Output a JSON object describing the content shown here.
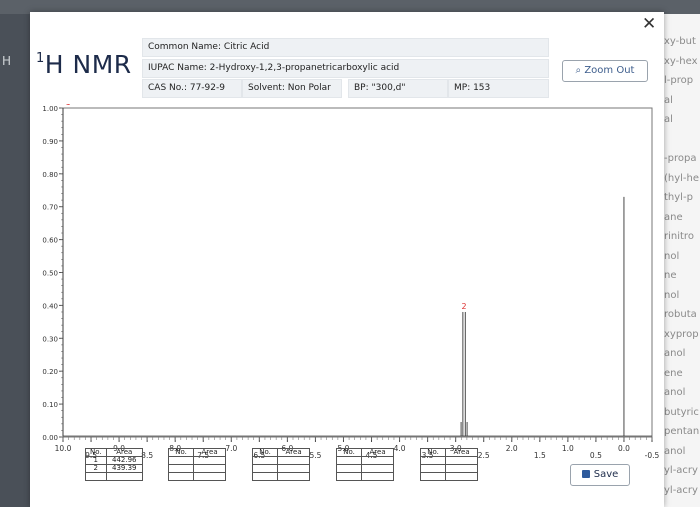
{
  "background": {
    "left_text": "H",
    "right_list": [
      "xy-but",
      "xy-hex",
      "l-prop",
      "al",
      "al",
      "",
      "-propa",
      "(hyl-he",
      "thyl-p",
      "ane",
      "rinitro",
      "nol",
      "ne",
      "nol",
      "robuta",
      "xyprop",
      "anol",
      "ene",
      "anol",
      "butyric",
      "pentan",
      "anol",
      "yl-acry",
      "yl-acry"
    ]
  },
  "dialog": {
    "title_main": "H NMR",
    "title_sup": "1",
    "close_glyph": "✕",
    "info": {
      "common_name": "Common Name: Citric Acid",
      "iupac_name": "IUPAC Name: 2-Hydroxy-1,2,3-propanetricarboxylic acid",
      "cas": "CAS No.: 77-92-9",
      "solvent": "Solvent: Non Polar",
      "bp": "BP: \"300,d\"",
      "mp": "MP: 153"
    },
    "zoom_label": "Zoom Out",
    "save_label": "Save"
  },
  "chart_data": {
    "type": "line",
    "xlabel": "",
    "ylabel": "",
    "x_ticks": [
      "10.0",
      "9.5",
      "9.0",
      "8.5",
      "8.0",
      "7.5",
      "7.0",
      "6.5",
      "6.0",
      "5.5",
      "5.0",
      "4.5",
      "4.0",
      "3.5",
      "3.0",
      "2.5",
      "2.0",
      "1.5",
      "1.0",
      "0.5",
      "0.0",
      "-0.5"
    ],
    "y_ticks": [
      "0.00",
      "0.10",
      "0.20",
      "0.30",
      "0.40",
      "0.50",
      "0.60",
      "0.70",
      "0.80",
      "0.90",
      "1.00"
    ],
    "xlim": [
      10.0,
      -0.5
    ],
    "ylim": [
      0,
      1.0
    ],
    "peaks": [
      {
        "label": "1",
        "x": 10.0,
        "height": 1.0
      },
      {
        "label": "2",
        "x": 2.85,
        "height": 0.38,
        "shape": "quartet"
      },
      {
        "label": "",
        "x": 0.0,
        "height": 0.73
      }
    ]
  },
  "integration_tables": [
    {
      "header_no": "No.",
      "header_area": "Area",
      "rows": [
        [
          "1",
          "442.96"
        ],
        [
          "2",
          "439.39"
        ]
      ]
    },
    {
      "header_no": "No.",
      "header_area": "Area",
      "rows": []
    },
    {
      "header_no": "No.",
      "header_area": "Area",
      "rows": []
    },
    {
      "header_no": "No.",
      "header_area": "Area",
      "rows": []
    },
    {
      "header_no": "No.",
      "header_area": "Area",
      "rows": []
    }
  ]
}
